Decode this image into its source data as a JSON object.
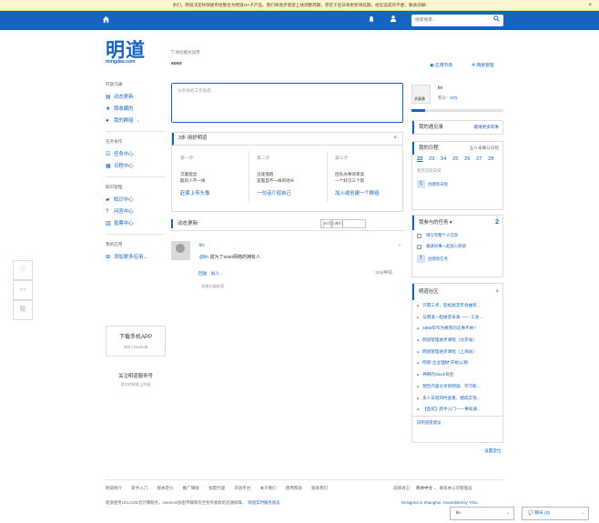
{
  "notice": {
    "text": "亲们，明道决定将快捷审批整合为明道OA子产品。我们将逐步观望上线调整周期，原定于后日将更新将延期。给您造成的不便，敬请谅解!",
    "close": "×"
  },
  "topbar": {
    "search_placeholder": "搜索搜索..."
  },
  "logo": {
    "cn": "明道",
    "en": "mingdao.com"
  },
  "company": {
    "mode": "体验模式试用",
    "name": "soso"
  },
  "header_links": {
    "app_market": "应用市场",
    "network_admin": "网络管理"
  },
  "sidebar": {
    "sections": [
      {
        "title": "开放沟通",
        "items": [
          "动态更新",
          "我收藏的",
          "我的群组"
        ]
      },
      {
        "title": "任务协作",
        "items": [
          "任务中心",
          "日程中心"
        ]
      },
      {
        "title": "知识管理",
        "items": [
          "知识中心",
          "问答中心",
          "投票中心"
        ]
      },
      {
        "title": "我的应用",
        "items": [
          "添加更多应用..."
        ]
      }
    ]
  },
  "download": {
    "title": "下载手机APP",
    "platforms": "iOS  |  Android"
  },
  "follow": {
    "title": "关注明道服务号",
    "sub": "用你的智能上明道"
  },
  "post": {
    "placeholder": "分享你的工作动态..."
  },
  "steps": {
    "title": "3步 用好明道",
    "close": "×",
    "items": [
      {
        "num": "第一步",
        "desc1": "沉着能显",
        "desc2": "殷的人不一样",
        "action": "赶紧上传头像"
      },
      {
        "num": "第二步",
        "desc1": "迅速落跑",
        "desc2": "是脑自不一样的他头",
        "action": "一句话介绍自己"
      },
      {
        "num": "第三步",
        "desc1": "团队办事效率高",
        "desc2": "一个好汉三个帮",
        "action": "加入或创建一个群组"
      }
    ]
  },
  "feed": {
    "title": "动态更新",
    "font_small": "A-",
    "font_large": "A+",
    "search_placeholder": "搜索动态",
    "entry": {
      "who": "lin:",
      "text_prefix": "@lin",
      "text": " 成为了soso网络的拥有人",
      "reply": "回复",
      "join": "加入...",
      "time": "31分钟前",
      "tag": "添加分类标签"
    }
  },
  "profile": {
    "name": "lin",
    "avatar_label": "求真像",
    "points_label": "积分：",
    "points": "570",
    "progress": 0.15
  },
  "encounters": {
    "title": "我的遇见录",
    "more": "邀请更多同事"
  },
  "calendar": {
    "title": "我的日程",
    "sync": "0 未确认日程",
    "days": [
      "22",
      "23",
      "24",
      "25",
      "26",
      "27",
      "28"
    ],
    "none": "暂无日程安排",
    "new": "创建新日程"
  },
  "tasks": {
    "title": "我参与的任务",
    "count": "2",
    "items": [
      "填写完整个人信息",
      "邀请同事一起加入明道"
    ],
    "new": "创建新任务"
  },
  "club": {
    "title": "明道社区",
    "close": "×",
    "items": [
      "只需三步，轻松搞定年会抽奖...",
      "与明道一起展望未来 —— 工会...",
      "1985年作为教育的这事不帅?",
      "明道管理进步课程（北京站）",
      "明道管理进步课程（上海站）",
      "明道\"企业理财\"开始公测!",
      "神奇的Slack背后",
      "预告内容分享到明道、学习彰...",
      "多人日程同时查看、相成实现...",
      "【直贫】新手入门——事如通..."
    ],
    "footer": "向明道提建议"
  },
  "set_position": "设置定位",
  "footer": {
    "links": [
      "明道简介",
      "新手入门",
      "版本定价",
      "推广赚钱",
      "加盟代理",
      "开放平台",
      "关于我们",
      "使用帮助",
      "联系我们"
    ],
    "lang_label": "选择语言：",
    "lang": "简体中文",
    "company_mgmt": "联系本公司管理员",
    "legal": "明道使用UCLOUD云计算服务，Geetrust加密传输和符合金券收款的流通保障。",
    "status": "明道实时服务状态",
    "made_in": "Designed in Shanghai. Assembled by YOU."
  },
  "chat": {
    "self": "lin",
    "chat_label": "聊天 (0)"
  }
}
